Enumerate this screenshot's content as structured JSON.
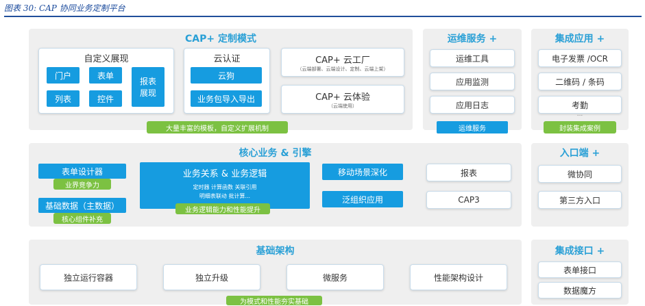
{
  "caption": "图表 30: CAP 协同业务定制平台",
  "cap_mode": {
    "title": "CAP+ 定制模式",
    "custom_display": {
      "title": "自定义展现",
      "portal": "门户",
      "form": "表单",
      "report_display": "报表\n展现",
      "list": "列表",
      "control": "控件"
    },
    "cloud_auth": {
      "title": "云认证",
      "cloud_dog": "云狗",
      "import_export": "业务包导入导出"
    },
    "cloud_factory": {
      "title": "CAP+ 云工厂",
      "sub": "（云端部署、云端设计、定制、云端上架）"
    },
    "cloud_exp": {
      "title": "CAP+ 云体验",
      "sub": "（云端使用）"
    },
    "tag": "大量丰富的模板，自定义扩展机制"
  },
  "ops": {
    "title": "运维服务 +",
    "items": [
      "运维工具",
      "应用监测",
      "应用日志"
    ],
    "tag": "运维服务"
  },
  "integration_app": {
    "title": "集成应用 +",
    "items": [
      "电子发票 /OCR",
      "二维码 / 条码",
      "考勤"
    ],
    "dots": "...",
    "tag": "封装集成案例"
  },
  "core": {
    "title": "核心业务 & 引擎",
    "form_designer": "表单设计器",
    "compete_tag": "业界竞争力",
    "master_data": "基础数据（主数据）",
    "core_tag": "核心组件补充",
    "biz_logic": {
      "title": "业务关系 & 业务逻辑",
      "line1": "定时器  计算函数  关联引用",
      "line2": "明细表联动  批计算..."
    },
    "perf_tag": "业务逻辑能力和性能提升",
    "mobile": "移动场景深化",
    "pan_org": "泛组织应用",
    "report": "报表",
    "cap3": "CAP3"
  },
  "entry": {
    "title": "入口端 +",
    "items": [
      "微协同",
      "第三方入口"
    ]
  },
  "infra": {
    "title": "基础架构",
    "items": [
      "独立运行容器",
      "独立升级",
      "微服务",
      "性能架构设计"
    ],
    "tag": "为模式和性能夯实基础"
  },
  "interface": {
    "title": "集成接口 +",
    "items": [
      "表单接口",
      "数据魔方"
    ]
  }
}
